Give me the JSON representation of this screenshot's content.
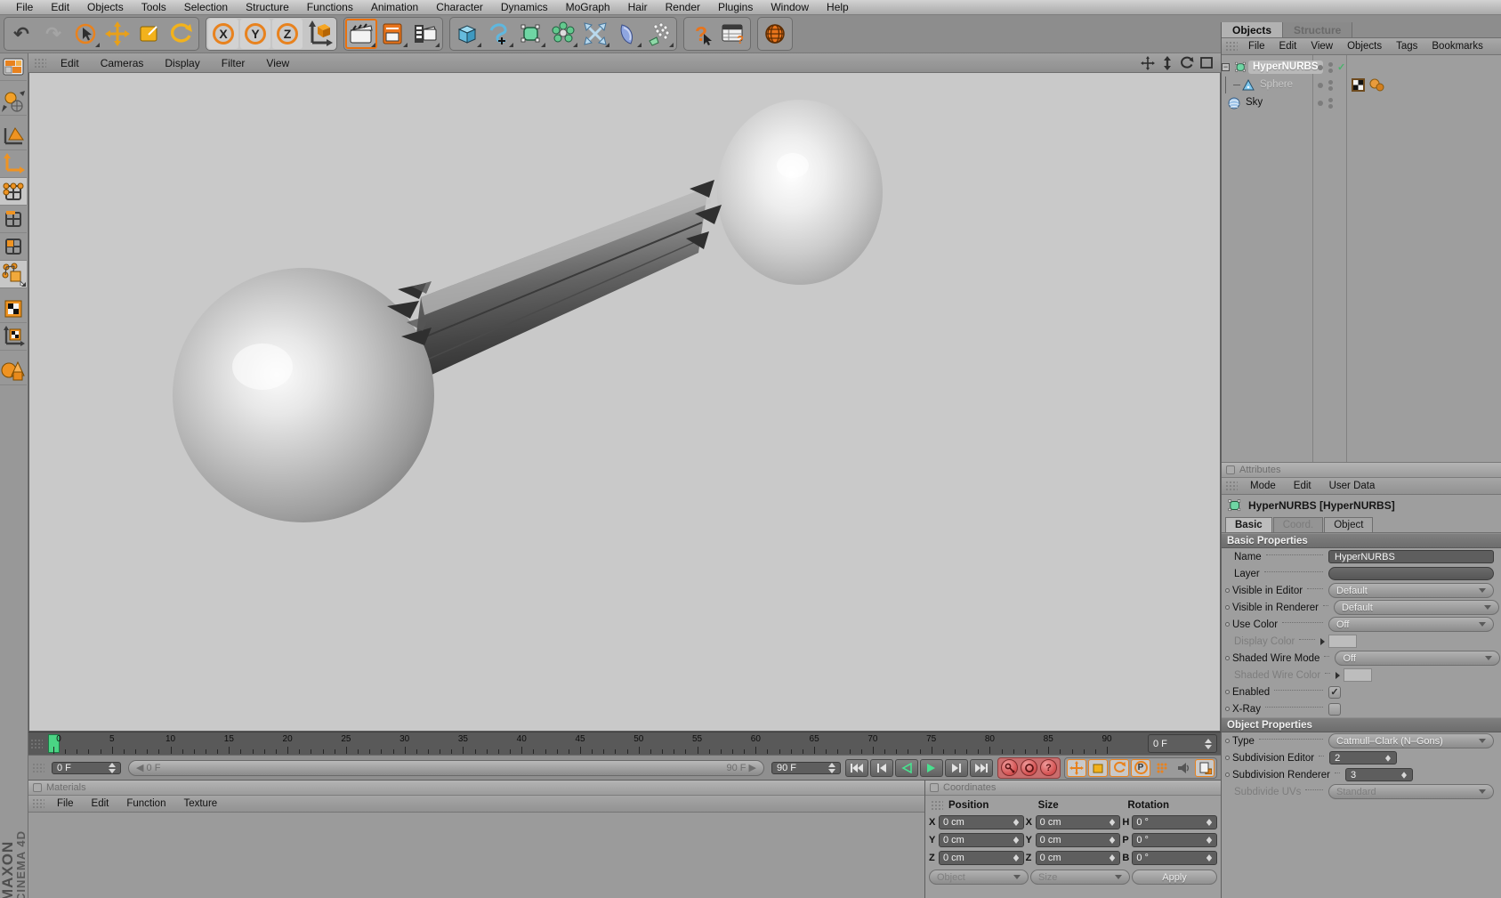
{
  "icons": {
    "undo": "↶",
    "redo": "↷",
    "check": "✓",
    "expand_minus": "−",
    "axis": [
      "X",
      "Y",
      "Z"
    ],
    "help": "?",
    "record_parameter": "P"
  },
  "menubar": {
    "items": [
      "File",
      "Edit",
      "Objects",
      "Tools",
      "Selection",
      "Structure",
      "Functions",
      "Animation",
      "Character",
      "Dynamics",
      "MoGraph",
      "Hair",
      "Render",
      "Plugins",
      "Window",
      "Help"
    ]
  },
  "viewport_menu": {
    "items": [
      "Edit",
      "Cameras",
      "Display",
      "Filter",
      "View"
    ]
  },
  "timeline": {
    "tick_labels": [
      "0",
      "5",
      "10",
      "15",
      "20",
      "25",
      "30",
      "35",
      "40",
      "45",
      "50",
      "55",
      "60",
      "65",
      "70",
      "75",
      "80",
      "85",
      "90"
    ],
    "tick_max": 90,
    "ruler_end_value": "0 F",
    "current_frame": "0 F",
    "slider_min": "0 F",
    "slider_max": "90 F",
    "range_end": "90 F"
  },
  "materials": {
    "title": "Materials",
    "menu": [
      "File",
      "Edit",
      "Function",
      "Texture"
    ]
  },
  "coordinates": {
    "title": "Coordinates",
    "headers": [
      "Position",
      "Size",
      "Rotation"
    ],
    "rows": [
      {
        "pos_label": "X",
        "pos": "0 cm",
        "size_label": "X",
        "size": "0 cm",
        "rot_label": "H",
        "rot": "0 °"
      },
      {
        "pos_label": "Y",
        "pos": "0 cm",
        "size_label": "Y",
        "size": "0 cm",
        "rot_label": "P",
        "rot": "0 °"
      },
      {
        "pos_label": "Z",
        "pos": "0 cm",
        "size_label": "Z",
        "size": "0 cm",
        "rot_label": "B",
        "rot": "0 °"
      }
    ],
    "object_mode": "Object",
    "size_mode": "Size",
    "apply_label": "Apply"
  },
  "object_manager": {
    "tabs": [
      {
        "label": "Objects",
        "active": true
      },
      {
        "label": "Structure",
        "active": false
      }
    ],
    "menu": [
      "File",
      "Edit",
      "View",
      "Objects",
      "Tags",
      "Bookmarks"
    ],
    "tree": [
      {
        "name": "HyperNURBS",
        "icon": "hypernurbs",
        "selected": true,
        "expander": true,
        "enabled_check": true
      },
      {
        "name": "Sphere",
        "icon": "sphere",
        "dimmed": true,
        "indent": true,
        "tags": [
          "texture-tag",
          "phong-tag"
        ]
      },
      {
        "name": "Sky",
        "icon": "sky"
      }
    ]
  },
  "attributes": {
    "title": "Attributes",
    "menu": [
      "Mode",
      "Edit",
      "User Data"
    ],
    "object_title": "HyperNURBS [HyperNURBS]",
    "tabs": [
      {
        "label": "Basic",
        "state": "active"
      },
      {
        "label": "Coord.",
        "state": "dim"
      },
      {
        "label": "Object",
        "state": "normal"
      }
    ],
    "sections": [
      {
        "header": "Basic Properties",
        "rows": [
          {
            "label": "Name",
            "control": {
              "type": "field",
              "value": "HyperNURBS"
            }
          },
          {
            "label": "Layer",
            "control": {
              "type": "field-empty",
              "value": ""
            }
          },
          {
            "label": "Visible in Editor",
            "dot": true,
            "control": {
              "type": "dropdown",
              "value": "Default"
            }
          },
          {
            "label": "Visible in Renderer",
            "dot": true,
            "control": {
              "type": "dropdown",
              "value": "Default"
            }
          },
          {
            "label": "Use Color",
            "dot": true,
            "control": {
              "type": "dropdown",
              "value": "Off"
            }
          },
          {
            "label": "Display Color",
            "dimmed": true,
            "arrow": true,
            "control": {
              "type": "swatch"
            }
          },
          {
            "label": "Shaded Wire Mode",
            "dot": true,
            "control": {
              "type": "dropdown",
              "value": "Off"
            }
          },
          {
            "label": "Shaded Wire Color",
            "dimmed": true,
            "arrow": true,
            "control": {
              "type": "swatch"
            }
          },
          {
            "label": "Enabled",
            "dot": true,
            "control": {
              "type": "checkbox",
              "checked": true
            }
          },
          {
            "label": "X-Ray",
            "dot": true,
            "control": {
              "type": "checkbox",
              "checked": false
            }
          }
        ]
      },
      {
        "header": "Object Properties",
        "rows": [
          {
            "label": "Type",
            "dot": true,
            "control": {
              "type": "dropdown",
              "value": "Catmull–Clark (N–Gons)"
            }
          },
          {
            "label": "Subdivision Editor",
            "dot": true,
            "control": {
              "type": "spinner",
              "value": "2"
            }
          },
          {
            "label": "Subdivision Renderer",
            "dot": true,
            "control": {
              "type": "spinner",
              "value": "3"
            }
          },
          {
            "label": "Subdivide UVs",
            "dimmed": true,
            "control": {
              "type": "dropdown",
              "value": "Standard",
              "dimmed": true
            }
          }
        ]
      }
    ]
  },
  "branding": {
    "line1": "MAXON",
    "line2": "CINEMA 4D"
  },
  "colors": {
    "accent_orange": "#e8821e",
    "playhead_green": "#4ad584",
    "viewport_bg": "#c9c9c9",
    "record_red": "#d34f4f"
  }
}
